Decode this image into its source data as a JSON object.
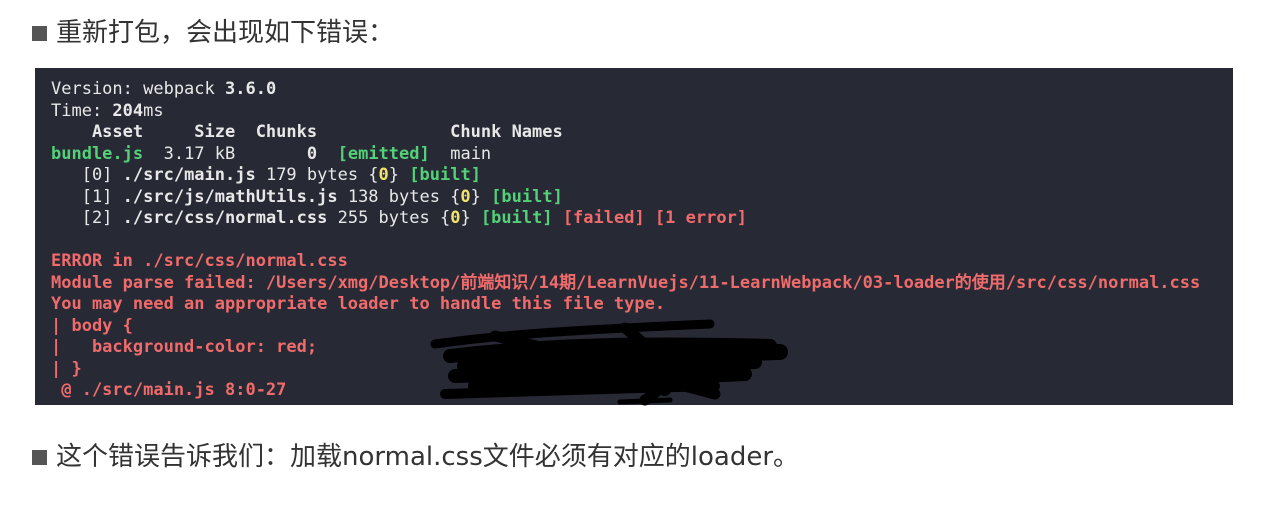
{
  "intro_text": "重新打包，会出现如下错误：",
  "conclusion_text": "这个错误告诉我们：加载normal.css文件必须有对应的loader。",
  "terminal": {
    "version_label": "Version: webpack ",
    "version_value": "3.6.0",
    "time_label": "Time: ",
    "time_value": "204",
    "time_unit": "ms",
    "table_header": "    Asset     Size  Chunks             Chunk Names",
    "bundle": {
      "name": "bundle.js",
      "size": "  3.17 kB       ",
      "chunk": "0",
      "status": "[emitted]",
      "chunk_name": "  main"
    },
    "modules": [
      {
        "index": "   [0] ",
        "path": "./src/main.js",
        "size": " 179 bytes {",
        "chunk": "0",
        "close": "} ",
        "built": "[built]",
        "extra": ""
      },
      {
        "index": "   [1] ",
        "path": "./src/js/mathUtils.js",
        "size": " 138 bytes {",
        "chunk": "0",
        "close": "} ",
        "built": "[built]",
        "extra": ""
      },
      {
        "index": "   [2] ",
        "path": "./src/css/normal.css",
        "size": " 255 bytes {",
        "chunk": "0",
        "close": "} ",
        "built": "[built]",
        "extra": " [failed] [1 error]"
      }
    ],
    "error_lines": [
      "ERROR in ./src/css/normal.css",
      "Module parse failed: /Users/xmg/Desktop/前端知识/14期/LearnVuejs/11-LearnWebpack/03-loader的使用/src/css/normal.css",
      "You may need an appropriate loader to handle this file type.",
      "| body {",
      "|   background-color: red;",
      "| }",
      " @ ./src/main.js 8:0-27"
    ]
  },
  "colors": {
    "terminal_bg": "#272a35",
    "text": "#e8e8e8",
    "green": "#53d078",
    "yellow": "#f1e36b",
    "red": "#f06b6b",
    "bullet": "#555555"
  }
}
